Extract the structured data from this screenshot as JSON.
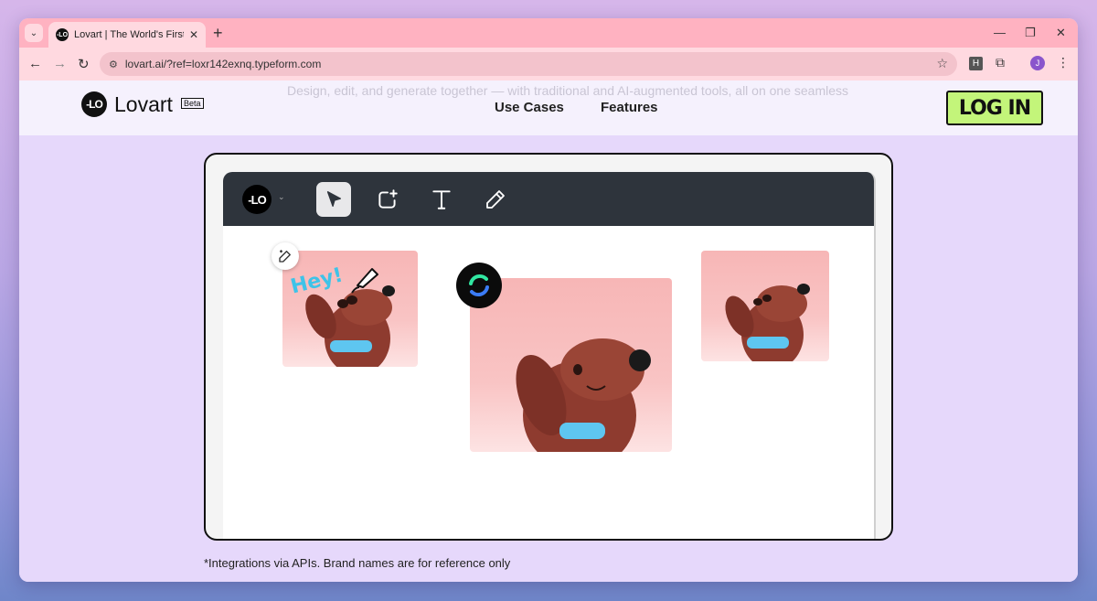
{
  "browser": {
    "tab_title": "Lovart | The World's First Design",
    "url": "lovart.ai/?ref=loxr142exnq.typeform.com",
    "profile_initial": "J",
    "extension_label": "H"
  },
  "site": {
    "logo_text": "Lovart",
    "beta_label": "Beta",
    "ghost_tagline": "Design, edit, and generate together — with traditional and AI-augmented tools, all on one seamless",
    "nav": [
      "Use Cases",
      "Features"
    ],
    "login_label": "LOG IN"
  },
  "demo": {
    "sticker_text": "Hey!"
  },
  "footnote": "*Integrations via APIs. Brand names are for reference only",
  "colors": {
    "tabstrip": "#ffb2c1",
    "login_bg": "#c3f57a",
    "app_toolbar": "#2e343c",
    "card_pink": "#f7b6b6",
    "dog": "#8e3b2f",
    "collar": "#5ec6f0",
    "sticker_text": "#3ec3e8"
  },
  "icons": [
    "tab-search-icon",
    "tab-close-icon",
    "new-tab-icon",
    "minimize-icon",
    "restore-icon",
    "window-close-icon",
    "back-icon",
    "forward-icon",
    "reload-icon",
    "site-info-icon",
    "bookmark-star-icon",
    "puzzle-icon",
    "kebab-menu-icon",
    "select-pointer-icon",
    "add-frame-icon",
    "text-tool-icon",
    "pen-tool-icon",
    "magic-edit-icon",
    "ai-model-icon"
  ]
}
